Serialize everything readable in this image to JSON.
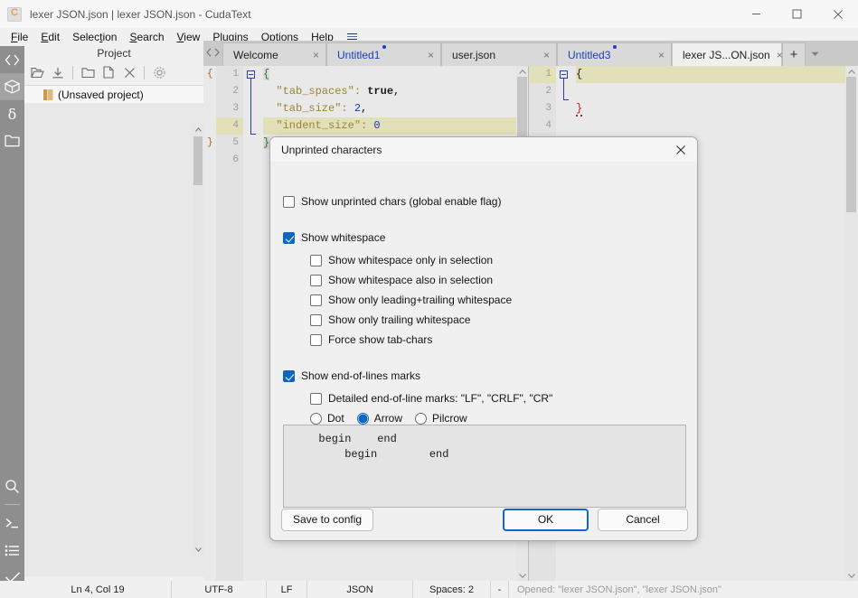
{
  "window": {
    "title": "lexer JSON.json | lexer JSON.json - CudaText",
    "logo": "cudatext-logo-icon",
    "controls": {
      "minimize": "minimize-icon",
      "maximize": "maximize-icon",
      "close": "close-icon"
    }
  },
  "menubar": {
    "items": [
      {
        "label": "File",
        "accel": "F"
      },
      {
        "label": "Edit",
        "accel": "E"
      },
      {
        "label": "Selection",
        "accel": "S"
      },
      {
        "label": "Search",
        "accel": "S"
      },
      {
        "label": "View",
        "accel": "V"
      },
      {
        "label": "Plugins",
        "accel": "P"
      },
      {
        "label": "Options",
        "accel": "O"
      },
      {
        "label": "Help",
        "accel": "H"
      }
    ],
    "burger": "hamburger-menu-icon"
  },
  "rail": {
    "top_items": [
      {
        "icon": "code-brackets-icon",
        "selected": false
      },
      {
        "icon": "package-box-icon",
        "selected": true
      },
      {
        "icon": "delta-snippet-icon",
        "selected": false
      },
      {
        "icon": "folder-icon",
        "selected": false
      }
    ],
    "bottom_items": [
      {
        "icon": "search-icon"
      },
      {
        "icon": "console-prompt-icon"
      },
      {
        "icon": "list-lines-icon"
      },
      {
        "icon": "checkmark-icon"
      }
    ]
  },
  "project": {
    "title": "Project",
    "toolbar": [
      {
        "icon": "open-folder-icon"
      },
      {
        "icon": "save-download-icon"
      },
      {
        "icon": "add-folder-icon"
      },
      {
        "icon": "add-file-icon"
      },
      {
        "icon": "remove-x-icon"
      },
      {
        "icon": "gear-icon"
      }
    ],
    "tree": [
      {
        "label": "(Unsaved project)",
        "icon": "project-book-icon"
      }
    ]
  },
  "tabs": {
    "nav_prev": "chevron-left-icon",
    "nav_next": "chevron-right-icon",
    "items": [
      {
        "label": "Welcome",
        "active": false,
        "modified": false
      },
      {
        "label": "Untitled1",
        "active": false,
        "modified": true
      },
      {
        "label": "user.json",
        "active": false,
        "modified": false
      },
      {
        "label": "Untitled3",
        "active": false,
        "modified": true
      },
      {
        "label": "lexer JS...ON.json",
        "active": true,
        "modified": false
      }
    ],
    "close_glyph": "×",
    "add_label": "+",
    "menu_icon": "chevron-down-icon"
  },
  "editor_left": {
    "fold_marks": [
      "{",
      "",
      "",
      "",
      "}",
      ""
    ],
    "line_numbers": [
      "1",
      "2",
      "3",
      "4",
      "5",
      "6"
    ],
    "current_line": 4,
    "lines": [
      {
        "n": 1,
        "tokens": [
          {
            "t": "{",
            "c": "brace"
          }
        ]
      },
      {
        "n": 2,
        "tokens": [
          {
            "t": "  \"tab_spaces\": ",
            "c": "key"
          },
          {
            "t": "true",
            "c": "bool"
          },
          {
            "t": ",",
            "c": "plain"
          }
        ]
      },
      {
        "n": 3,
        "tokens": [
          {
            "t": "  \"tab_size\": ",
            "c": "key"
          },
          {
            "t": "2",
            "c": "num"
          },
          {
            "t": ",",
            "c": "plain"
          }
        ]
      },
      {
        "n": 4,
        "tokens": [
          {
            "t": "  \"indent_size\": ",
            "c": "key"
          },
          {
            "t": "0",
            "c": "num"
          }
        ]
      },
      {
        "n": 5,
        "tokens": [
          {
            "t": "}",
            "c": "brace"
          }
        ]
      },
      {
        "n": 6,
        "tokens": []
      }
    ]
  },
  "editor_right": {
    "line_numbers": [
      "1",
      "2",
      "3",
      "4"
    ],
    "current_line": 1,
    "lines": [
      {
        "n": 1,
        "tokens": [
          {
            "t": "{",
            "c": "plain"
          }
        ]
      },
      {
        "n": 2,
        "tokens": []
      },
      {
        "n": 3,
        "tokens": [
          {
            "t": "}",
            "c": "err"
          }
        ]
      },
      {
        "n": 4,
        "tokens": []
      }
    ]
  },
  "statusbar": {
    "caret": "Ln 4, Col 19",
    "encoding": "UTF-8",
    "line_ends": "LF",
    "lexer": "JSON",
    "indent": "Spaces: 2",
    "extra": "-",
    "message": "Opened: \"lexer JSON.json\", \"lexer JSON.json\""
  },
  "dialog": {
    "title": "Unprinted characters",
    "close_icon": "close-icon",
    "global_flag": {
      "label": "Show unprinted chars (global enable flag)",
      "checked": false
    },
    "whitespace": {
      "label": "Show whitespace",
      "checked": true,
      "children": [
        {
          "label": "Show whitespace only in selection",
          "checked": false
        },
        {
          "label": "Show whitespace also in selection",
          "checked": false
        },
        {
          "label": "Show only leading+trailing whitespace",
          "checked": false
        },
        {
          "label": "Show only trailing whitespace",
          "checked": false
        },
        {
          "label": "Force show tab-chars",
          "checked": false
        }
      ]
    },
    "eol": {
      "label": "Show end-of-lines marks",
      "checked": true,
      "detailed": {
        "label": "Detailed end-of-line marks: \"LF\", \"CRLF\", \"CR\"",
        "checked": false
      },
      "style_options": [
        {
          "label": "Dot",
          "selected": false
        },
        {
          "label": "Arrow",
          "selected": true
        },
        {
          "label": "Pilcrow",
          "selected": false
        }
      ]
    },
    "preview": {
      "lines": [
        "  begin    end",
        "      begin        end"
      ]
    },
    "buttons": {
      "save": "Save to config",
      "ok": "OK",
      "cancel": "Cancel"
    }
  },
  "colors": {
    "accent": "#0b66c3",
    "focus_border": "#1266c8",
    "tab_modified": "#1a3fb8",
    "error": "#b02020",
    "rail_bg": "#8e8e8e"
  }
}
